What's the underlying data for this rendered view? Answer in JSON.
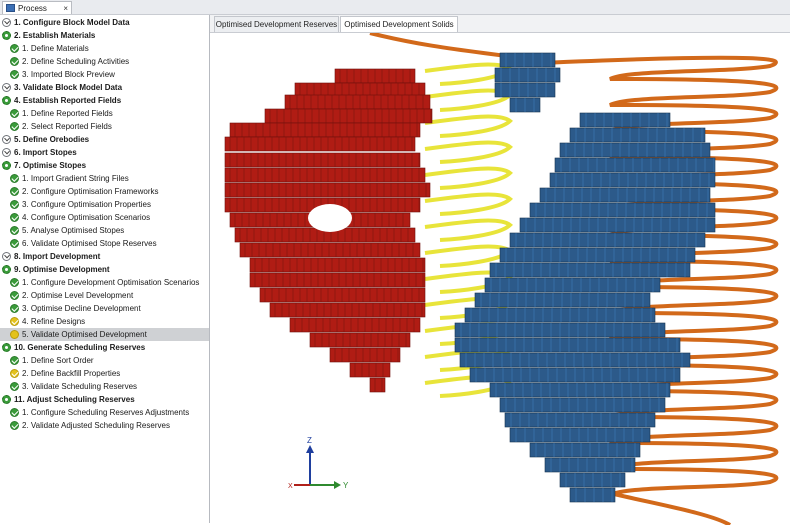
{
  "process_tab": {
    "title": "Process",
    "close": "×"
  },
  "steps": [
    {
      "label": "1. Configure Block Model Data",
      "level": 0,
      "icon": "collapse"
    },
    {
      "label": "2. Establish Materials",
      "level": 0,
      "icon": "gear"
    },
    {
      "label": "1. Define Materials",
      "level": 1,
      "icon": "check"
    },
    {
      "label": "2. Define Scheduling Activities",
      "level": 1,
      "icon": "check"
    },
    {
      "label": "3. Imported Block Preview",
      "level": 1,
      "icon": "check"
    },
    {
      "label": "3. Validate Block Model Data",
      "level": 0,
      "icon": "collapse"
    },
    {
      "label": "4. Establish Reported Fields",
      "level": 0,
      "icon": "gear"
    },
    {
      "label": "1. Define Reported Fields",
      "level": 1,
      "icon": "check"
    },
    {
      "label": "2. Select Reported Fields",
      "level": 1,
      "icon": "check"
    },
    {
      "label": "5. Define Orebodies",
      "level": 0,
      "icon": "collapse"
    },
    {
      "label": "6. Import Stopes",
      "level": 0,
      "icon": "collapse"
    },
    {
      "label": "7. Optimise Stopes",
      "level": 0,
      "icon": "gear"
    },
    {
      "label": "1. Import Gradient String Files",
      "level": 1,
      "icon": "check"
    },
    {
      "label": "2. Configure Optimisation Frameworks",
      "level": 1,
      "icon": "check"
    },
    {
      "label": "3. Configure Optimisation Properties",
      "level": 1,
      "icon": "check"
    },
    {
      "label": "4. Configure Optimisation Scenarios",
      "level": 1,
      "icon": "check"
    },
    {
      "label": "5. Analyse Optimised Stopes",
      "level": 1,
      "icon": "check"
    },
    {
      "label": "6. Validate Optimised Stope Reserves",
      "level": 1,
      "icon": "check"
    },
    {
      "label": "8. Import Development",
      "level": 0,
      "icon": "collapse"
    },
    {
      "label": "9. Optimise Development",
      "level": 0,
      "icon": "gear"
    },
    {
      "label": "1. Configure Development Optimisation Scenarios",
      "level": 1,
      "icon": "check"
    },
    {
      "label": "2. Optimise Level Development",
      "level": 1,
      "icon": "check"
    },
    {
      "label": "3. Optimise Decline Development",
      "level": 1,
      "icon": "check"
    },
    {
      "label": "4. Refine Designs",
      "level": 1,
      "icon": "warn"
    },
    {
      "label": "5. Validate Optimised Development",
      "level": 1,
      "icon": "warn2",
      "selected": true
    },
    {
      "label": "10. Generate Scheduling Reserves",
      "level": 0,
      "icon": "gear"
    },
    {
      "label": "1. Define Sort Order",
      "level": 1,
      "icon": "check"
    },
    {
      "label": "2. Define Backfill Properties",
      "level": 1,
      "icon": "warn"
    },
    {
      "label": "3. Validate Scheduling Reserves",
      "level": 1,
      "icon": "check"
    },
    {
      "label": "11. Adjust Scheduling Reserves",
      "level": 0,
      "icon": "gear"
    },
    {
      "label": "1. Configure Scheduling Reserves Adjustments",
      "level": 1,
      "icon": "check"
    },
    {
      "label": "2. Validate Adjusted Scheduling Reserves",
      "level": 1,
      "icon": "check"
    }
  ],
  "view_tabs": [
    {
      "label": "Optimised Development Reserves",
      "active": false
    },
    {
      "label": "Optimised Development Solids",
      "active": true
    }
  ],
  "axes": {
    "z": "Z",
    "x": "X",
    "y": "Y"
  },
  "colors": {
    "stope_red": "#b01c14",
    "stope_blue": "#2c5a8a",
    "decline_orange": "#d2691a",
    "development_yellow": "#e8e43a",
    "selected_row": "#cfd1d4"
  }
}
